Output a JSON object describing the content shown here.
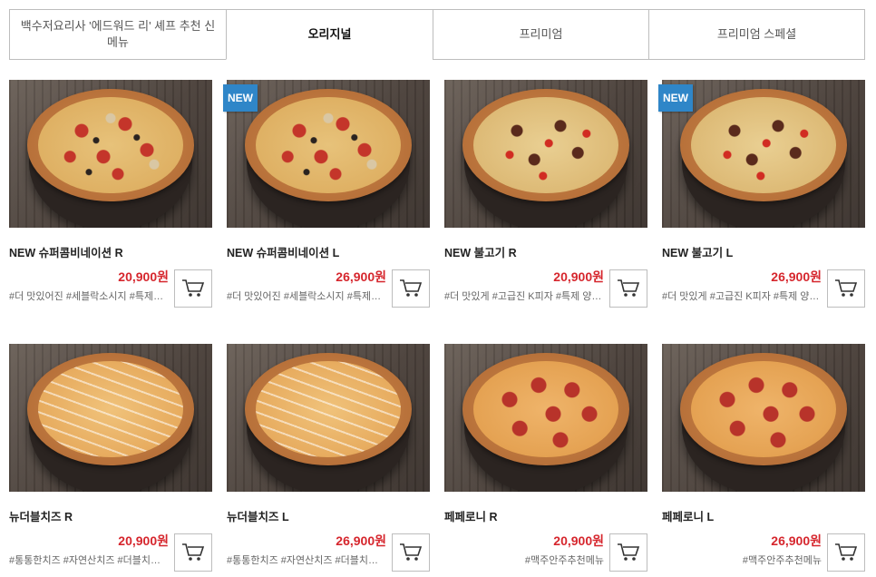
{
  "tabs": [
    {
      "label": "백수저요리사 '에드워드 리' 셰프 추천 신메뉴",
      "active": false
    },
    {
      "label": "오리지널",
      "active": true
    },
    {
      "label": "프리미엄",
      "active": false
    },
    {
      "label": "프리미엄 스페셜",
      "active": false
    }
  ],
  "badge_label": "NEW",
  "icons": {
    "cart": "cart-icon"
  },
  "colors": {
    "price": "#d6262d",
    "badge": "#2f86c8"
  },
  "products": [
    {
      "name": "NEW 슈퍼콤비네이션 R",
      "price": "20,900원",
      "tags": "#더 맛있어진 #세블락소시지 #특제양념",
      "new": false
    },
    {
      "name": "NEW 슈퍼콤비네이션 L",
      "price": "26,900원",
      "tags": "#더 맛있어진 #세블락소시지 #특제양념",
      "new": true
    },
    {
      "name": "NEW 불고기 R",
      "price": "20,900원",
      "tags": "#더 맛있게 #고급진 K피자 #특제 양념소스",
      "new": false
    },
    {
      "name": "NEW 불고기 L",
      "price": "26,900원",
      "tags": "#더 맛있게 #고급진 K피자 #특제 양념소스",
      "new": true
    },
    {
      "name": "뉴더블치즈 R",
      "price": "20,900원",
      "tags": "#통통한치즈 #자연산치즈 #더블치즈피자",
      "new": false
    },
    {
      "name": "뉴더블치즈 L",
      "price": "26,900원",
      "tags": "#통통한치즈 #자연산치즈 #더블치즈피자",
      "new": false
    },
    {
      "name": "페페로니 R",
      "price": "20,900원",
      "tags": "#맥주안주추천메뉴",
      "new": false
    },
    {
      "name": "페페로니 L",
      "price": "26,900원",
      "tags": "#맥주안주추천메뉴",
      "new": false
    }
  ]
}
